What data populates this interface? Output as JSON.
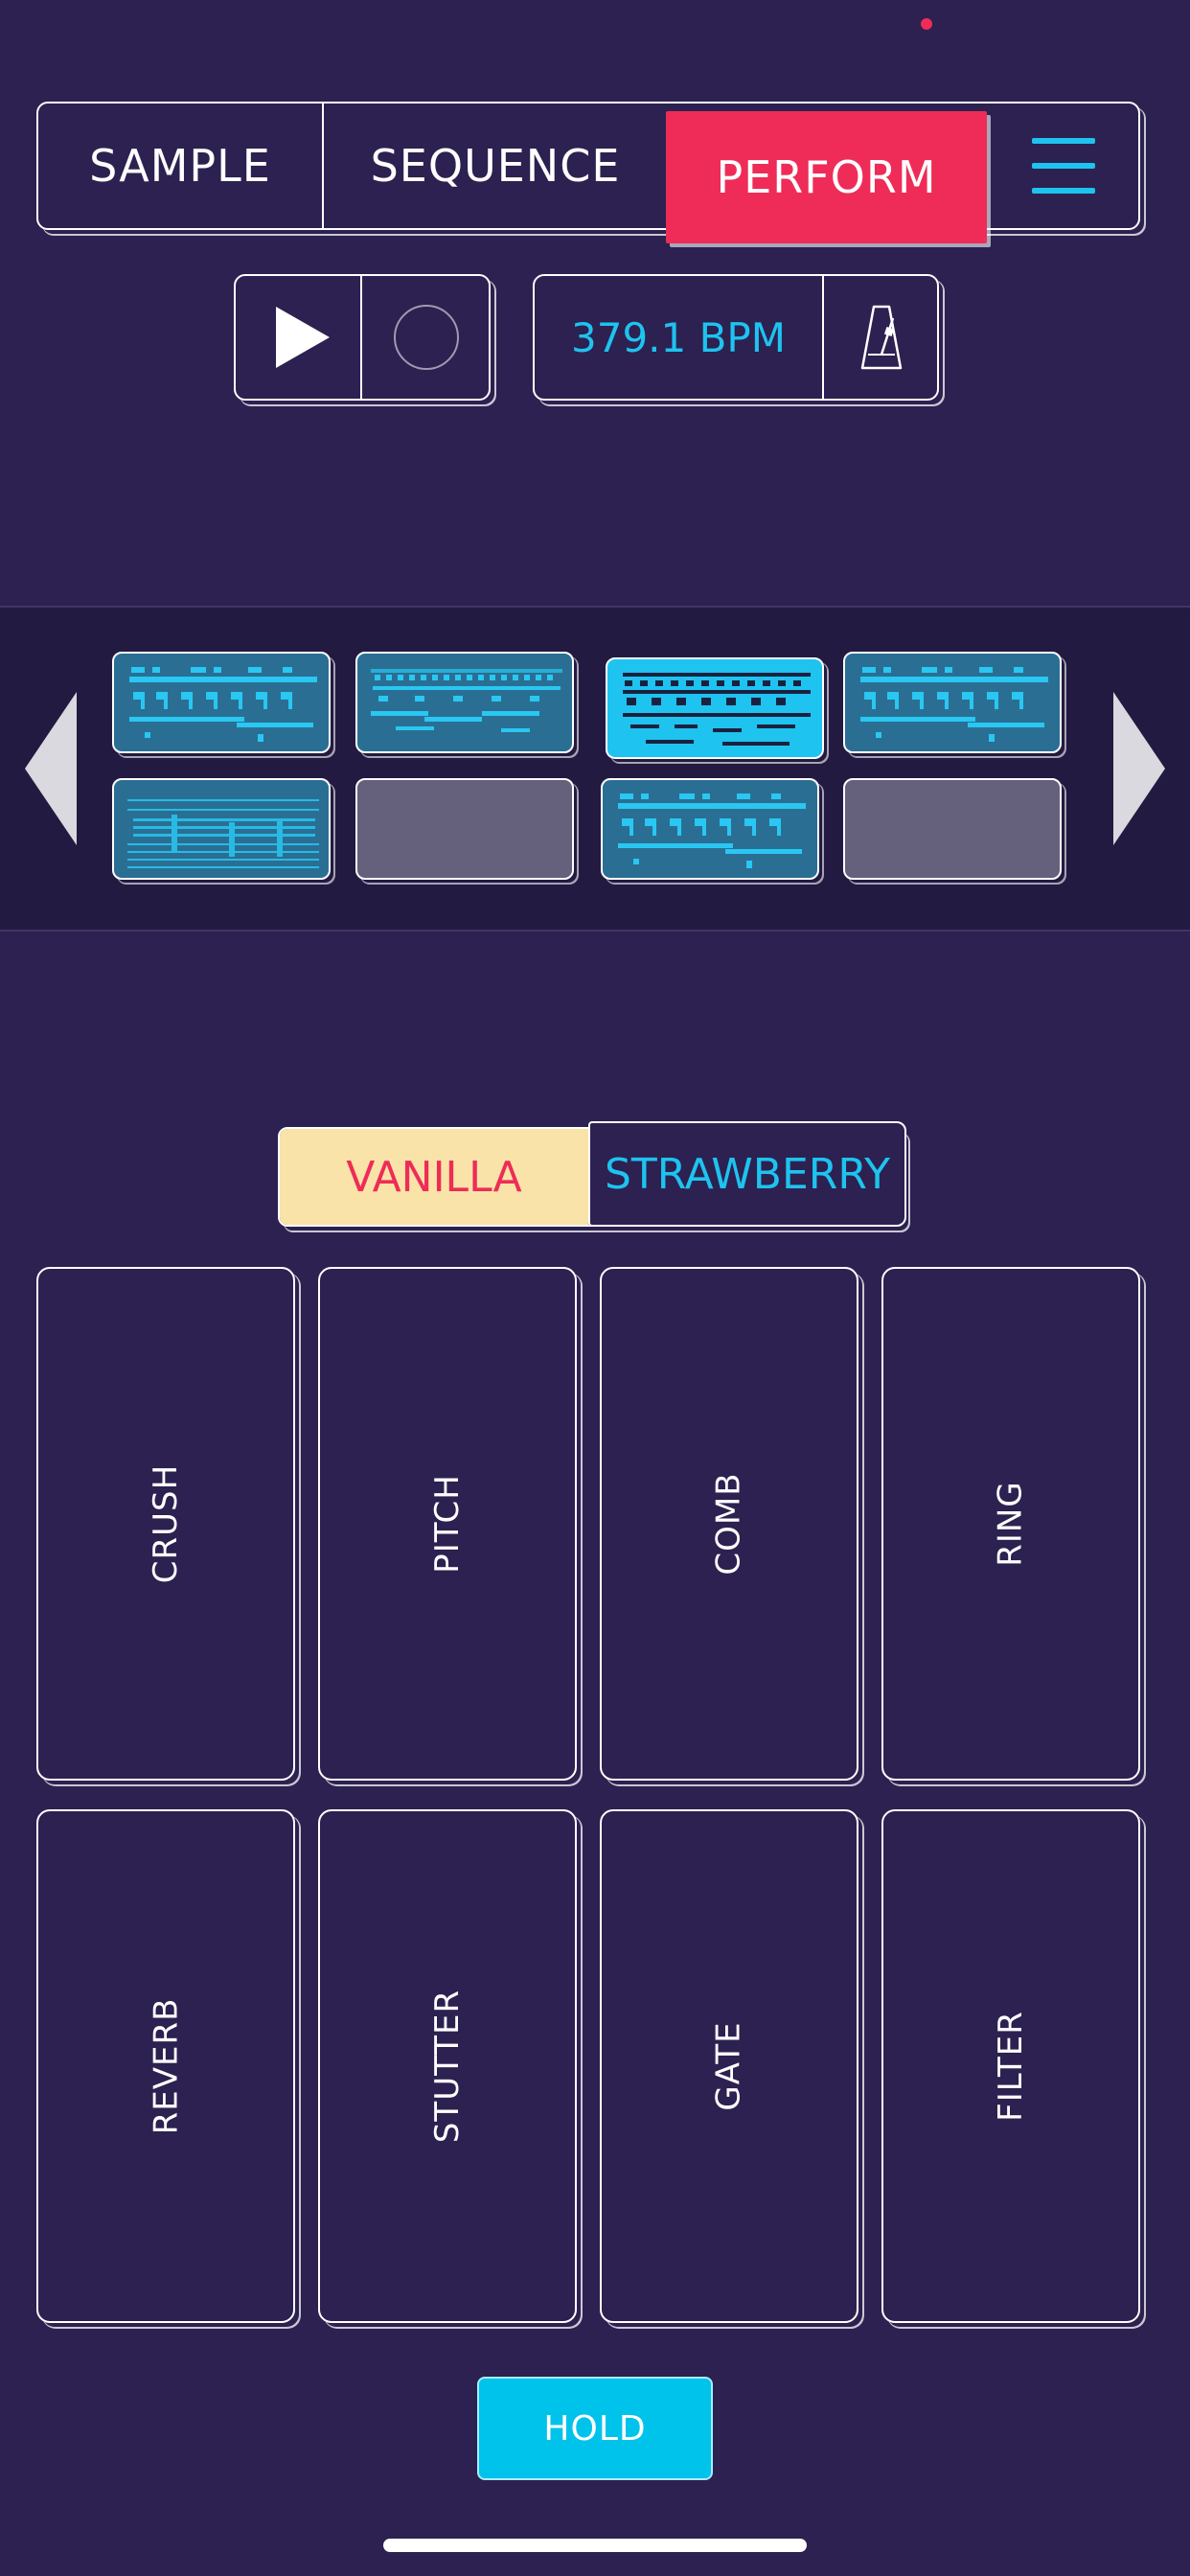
{
  "tabs": [
    {
      "label": "SAMPLE",
      "selected": false
    },
    {
      "label": "SEQUENCE",
      "selected": false
    },
    {
      "label": "PERFORM",
      "selected": true
    }
  ],
  "menu_icon": "hamburger-menu-icon",
  "transport": {
    "play_icon": "play-icon",
    "record_icon": "record-icon",
    "bpm_label": "379.1 BPM",
    "metronome_icon": "metronome-icon"
  },
  "patterns": {
    "prev_icon": "chevron-left-icon",
    "next_icon": "chevron-right-icon",
    "slots": [
      {
        "state": "filled"
      },
      {
        "state": "filled"
      },
      {
        "state": "active"
      },
      {
        "state": "filled"
      },
      {
        "state": "filled"
      },
      {
        "state": "empty"
      },
      {
        "state": "filled"
      },
      {
        "state": "empty"
      }
    ]
  },
  "flavor": {
    "options": [
      "VANILLA",
      "STRAWBERRY"
    ],
    "selected": "VANILLA"
  },
  "effects": {
    "row1": [
      "CRUSH",
      "PITCH",
      "COMB",
      "RING"
    ],
    "row2": [
      "REVERB",
      "STUTTER",
      "GATE",
      "FILTER"
    ]
  },
  "hold_label": "HOLD",
  "colors": {
    "background": "#2c2150",
    "accent_red": "#ee2c57",
    "accent_cyan": "#1ec3ef",
    "vanilla": "#fae3a8",
    "pattern_filled": "#2a6f93",
    "pattern_empty": "#65607c"
  }
}
